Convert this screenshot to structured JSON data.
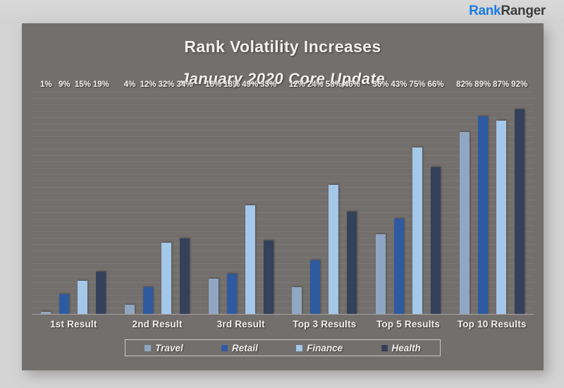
{
  "brand": {
    "name_part1": "Rank",
    "name_part2": "Ranger",
    "color_primary": "#1f7be0",
    "color_secondary": "#3d3d3d"
  },
  "panel": {
    "background_color": "#736f6d",
    "page_background_color": "#d4d4d4"
  },
  "chart_data": {
    "type": "bar",
    "title": "Rank Volatility Increases",
    "subtitle": "January 2020 Core Update",
    "xlabel": "",
    "ylabel": "",
    "ylim": [
      0,
      100
    ],
    "grid": true,
    "legend_position": "bottom",
    "value_suffix": "%",
    "categories": [
      "1st Result",
      "2nd Result",
      "3rd Result",
      "Top 3 Results",
      "Top 5 Results",
      "Top 10 Results"
    ],
    "series": [
      {
        "name": "Travel",
        "color": "#8fa7c2",
        "values": [
          1,
          4,
          16,
          12,
          36,
          82
        ],
        "labels": [
          "1%",
          "4%",
          "16%",
          "12%",
          "36%",
          "82%"
        ]
      },
      {
        "name": "Retail",
        "color": "#2e5aa0",
        "values": [
          9,
          12,
          18,
          24,
          43,
          89
        ],
        "labels": [
          "9%",
          "12%",
          "18%",
          "24%",
          "43%",
          "89%"
        ]
      },
      {
        "name": "Finance",
        "color": "#a3c8ea",
        "values": [
          15,
          32,
          49,
          58,
          75,
          87
        ],
        "labels": [
          "15%",
          "32%",
          "49%",
          "58%",
          "75%",
          "87%"
        ]
      },
      {
        "name": "Health",
        "color": "#34415a",
        "values": [
          19,
          34,
          33,
          46,
          66,
          92
        ],
        "labels": [
          "19%",
          "34%",
          "33%",
          "46%",
          "66%",
          "92%"
        ]
      }
    ]
  }
}
